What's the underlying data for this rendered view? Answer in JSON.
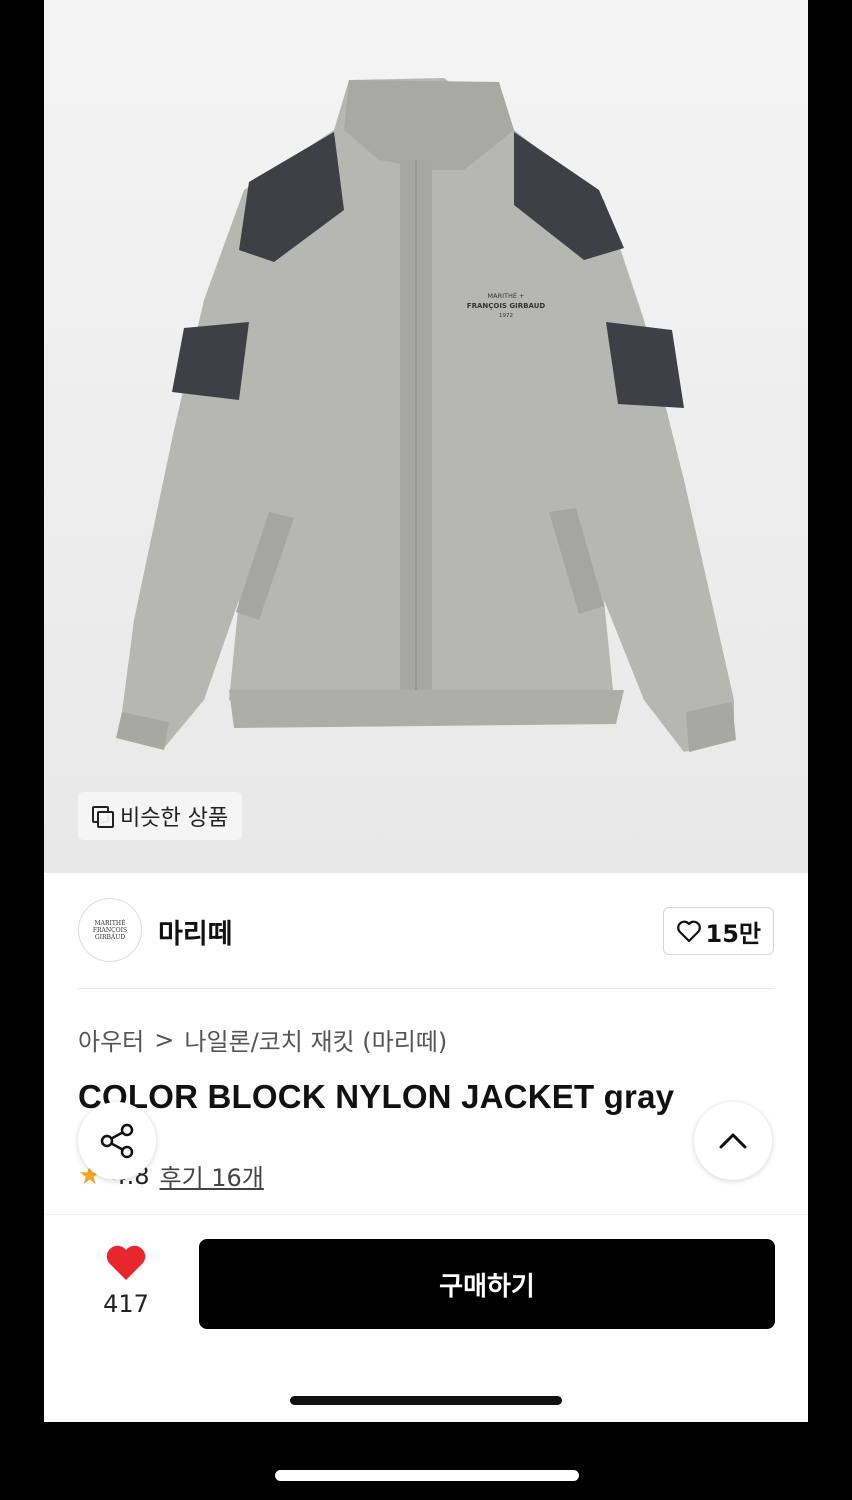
{
  "hero": {
    "jacket_print": [
      "MARITHÉ +",
      "FRANÇOIS GIRBAUD",
      "1972"
    ],
    "similar_label": "비슷한 상품"
  },
  "brand": {
    "logo_text": [
      "MARITHÉ",
      "FRANÇOIS",
      "GIRBAUD"
    ],
    "name": "마리떼",
    "like_count": "15만"
  },
  "breadcrumb": {
    "category": "아우터",
    "separator": ">",
    "subcategory": "나일론/코치 재킷 (마리떼)"
  },
  "product": {
    "title": "COLOR BLOCK NYLON JACKET gray",
    "rating": "4.8",
    "review_label": "후기 16개"
  },
  "bottom_bar": {
    "wish_count": "417",
    "buy_label": "구매하기"
  },
  "colors": {
    "accent": "#e8262b",
    "buy_bg": "#000000",
    "star": "#f5a623"
  }
}
